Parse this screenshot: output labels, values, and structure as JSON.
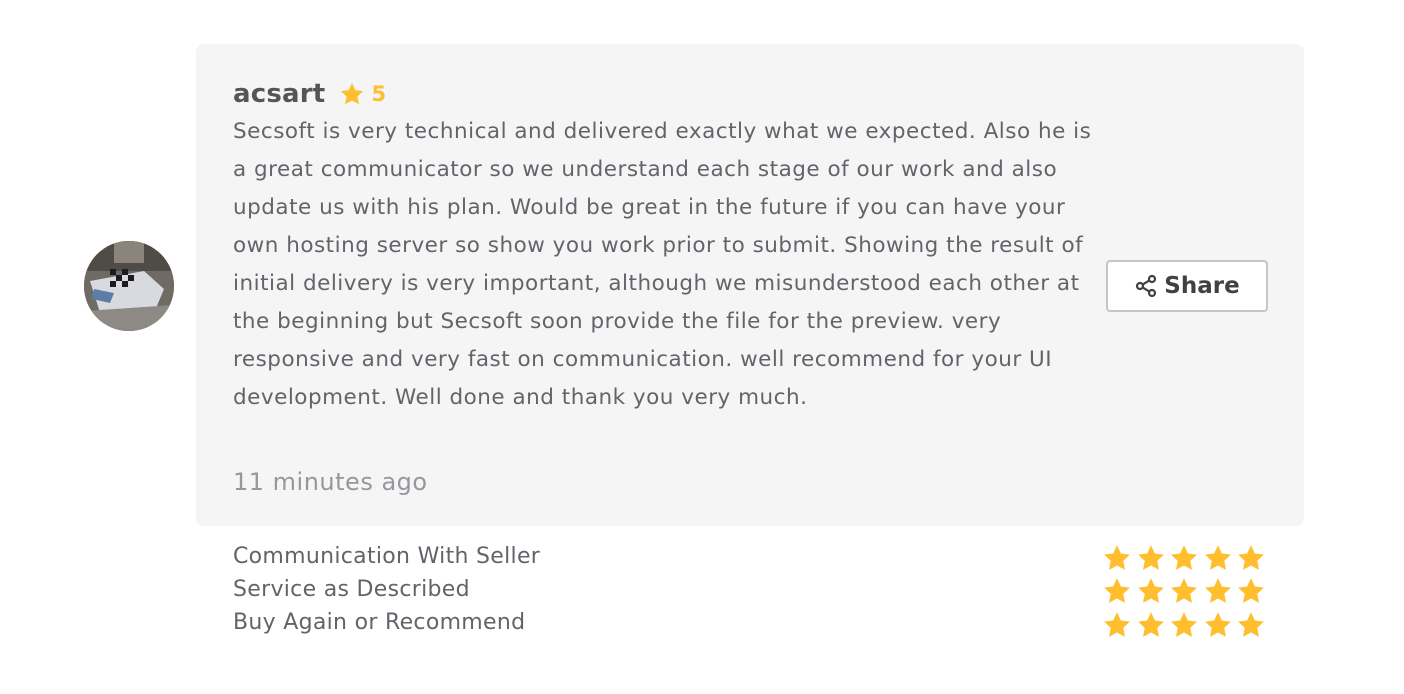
{
  "review": {
    "username": "acsart",
    "rating": "5",
    "text": "Secsoft is very technical and delivered exactly what we expected. Also he is a great communicator so we understand each stage of our work and also update us with his plan. Would be great in the future if you can have your own hosting server so show you work prior to submit. Showing the result of initial delivery is very important, although we misunderstood each other at the beginning but Secsoft soon provide the file for the preview. very responsive and very fast on communication. well recommend for your UI development. Well done and thank you very much.",
    "timestamp": "11 minutes ago",
    "share_label": "Share"
  },
  "criteria": [
    {
      "label": "Communication With Seller",
      "stars": 5
    },
    {
      "label": "Service as Described",
      "stars": 5
    },
    {
      "label": "Buy Again or Recommend",
      "stars": 5
    }
  ],
  "icons": {
    "rating": "star-icon",
    "share": "share-icon"
  },
  "colors": {
    "star": "#ffbe2e",
    "card_background": "#f5f5f5",
    "text": "#62646a",
    "muted": "#95979d"
  }
}
